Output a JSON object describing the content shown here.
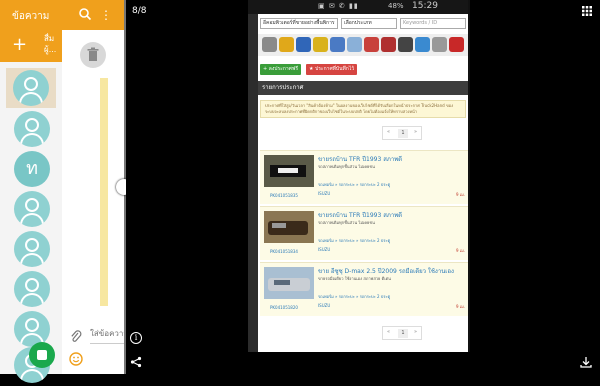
{
  "chat_app": {
    "title": "ข้อความ",
    "action_label": "สื่ม ผู้...",
    "add_label": "+",
    "message_placeholder": "ใส่ข้อความ",
    "contact_letter": "ท"
  },
  "viewer": {
    "page_counter": "8/8",
    "info_label": "i"
  },
  "photo": {
    "status_battery": "48%",
    "status_time": "15:29",
    "select_1": "อีคอมพิวเตอร์ที่ขายอย่างพื้นพิการ",
    "select_2": "เลือกประเภท",
    "select_3": "Keywords / ID",
    "btn_post": "+ ลงประกาศฟรี",
    "btn_fav": "★ ประกาศที่บันทึกไว้",
    "list_header": "รายการประกาศ",
    "notice": "ประกาศที่ใส่สูง/วันเวลา \"สินค้าต้องห้าม\" ในผลงานของเว็บไซต์ที่ได้รับเลือกในหน้าประกาศ Truck2Hand ของระบบจะลบลงประกาศที่ผิดกติกาของเว็บไซต์ในระบบปกติ โดยไม่ต้องแจ้งให้ทราบล่วงหน้า",
    "pager_current": "1",
    "pager_prev": "«",
    "pager_next": "»",
    "listings": [
      {
        "title": "ขายรถบ้าน TFR ปี1993 สภาพดี",
        "subtitle": "รถสภาพเดิมทุกชิ้นส่วน ไม่เคยชน",
        "category": "รถเพอร์ม » รถกระบะ » รถกระบะ 2 ประตู",
        "brand": "ISUZU",
        "code": "PK041051835",
        "date": "9 เม."
      },
      {
        "title": "ขายรถบ้าน TFR ปี1993 สภาพดี",
        "subtitle": "รถสภาพเดิมทุกชิ้นส่วน ไม่เคยชน",
        "category": "รถเพอร์ม » รถกระบะ » รถกระบะ 2 ประตู",
        "brand": "ISUZU",
        "code": "PK041051834",
        "date": "9 เม."
      },
      {
        "title": "ขาย อีซูซุ D-max 2.5 ปี2009 รถมือเดียว ใช้งานเอง",
        "subtitle": "ขายรถมือเดียว ใช้งานเอง สภาพสวย ดีเด่น",
        "category": "รถเพอร์ม » รถกระบะ » รถกระบะ 2 ประตู",
        "brand": "ISUZU",
        "code": "PK041051820",
        "date": "9 เม."
      }
    ]
  },
  "colors": {
    "header": "#f0a01c",
    "avatar": "#8fd1d1",
    "fab": "#1aa84c",
    "btn_green": "#3a9d3a",
    "btn_red": "#d64541"
  }
}
